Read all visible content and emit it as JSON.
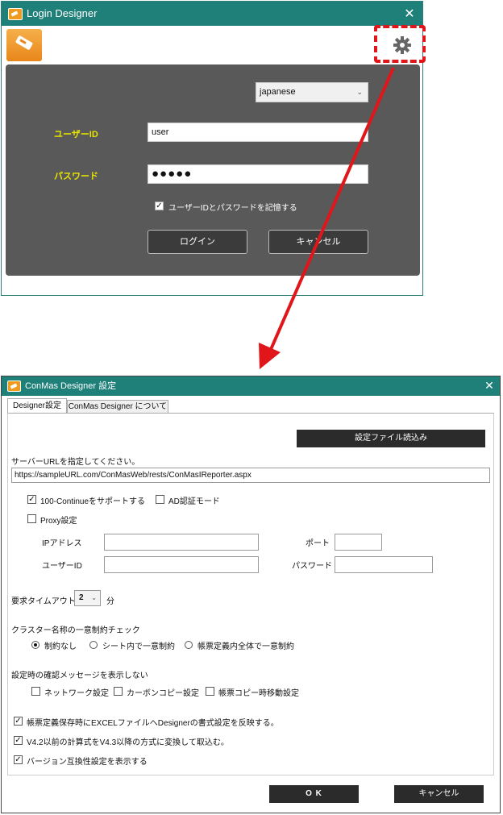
{
  "login": {
    "title": "Login Designer",
    "close": "✕",
    "language": "japanese",
    "userid_label": "ユーザーID",
    "userid_value": "user",
    "password_label": "パスワード",
    "password_value": "●●●●●",
    "remember_label": "ユーザーIDとパスワードを記憶する",
    "login_button": "ログイン",
    "cancel_button": "キャンセル"
  },
  "settings": {
    "title": "ConMas Designer 設定",
    "close": "✕",
    "tabs": [
      {
        "label": "Designer設定"
      },
      {
        "label": "ConMas Designer について"
      }
    ],
    "load_button": "設定ファイル読込み",
    "server_url_label": "サーバーURLを指定してください。",
    "server_url_value": "https://sampleURL.com/ConMasWeb/rests/ConMasIReporter.aspx",
    "continue_label": "100-Continueをサポートする",
    "ad_label": "AD認証モード",
    "proxy_label": "Proxy設定",
    "ip_label": "IPアドレス",
    "port_label": "ポート",
    "proxy_user_label": "ユーザーID",
    "proxy_password_label": "パスワード",
    "timeout_label": "要求タイムアウト",
    "timeout_value": "2",
    "timeout_unit": "分",
    "cluster_label": "クラスター名称の一意制約チェック",
    "radio_options": [
      {
        "label": "制約なし"
      },
      {
        "label": "シート内で一意制約"
      },
      {
        "label": "帳票定義内全体で一意制約"
      }
    ],
    "confirm_label": "設定時の確認メッセージを表示しない",
    "confirm_options": [
      {
        "label": "ネットワーク設定"
      },
      {
        "label": "カーボンコピー設定"
      },
      {
        "label": "帳票コピー時移動設定"
      }
    ],
    "check_excel": "帳票定義保存時にEXCELファイルへDesignerの書式設定を反映する。",
    "check_v42": "V4.2以前の計算式をV4.3以降の方式に変換して取込む。",
    "check_version": "バージョン互換性設定を表示する",
    "ok_button": "O K",
    "cancel_button": "キャンセル"
  },
  "colors": {
    "titlebar": "#1f7f79",
    "highlight": "#e0161b",
    "arrow": "#e0161b"
  }
}
